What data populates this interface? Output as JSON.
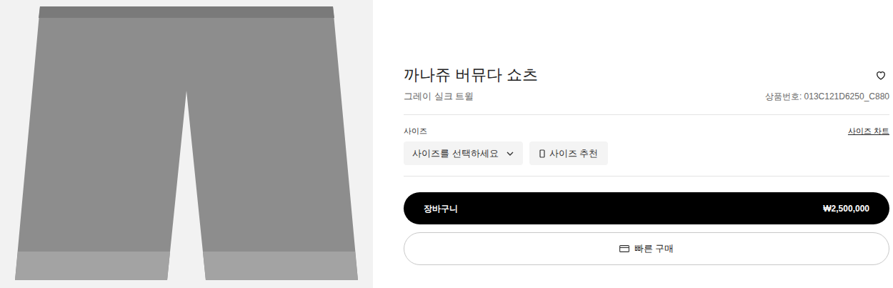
{
  "product": {
    "title": "까나쥬 버뮤다 쇼츠",
    "subtitle": "그레이 실크 트윌",
    "sku": "상품번호: 013C121D6250_C880"
  },
  "size": {
    "label": "사이즈",
    "chart_link": "사이즈 차트",
    "select_placeholder": "사이즈를 선택하세요",
    "recommend": "사이즈 추천"
  },
  "cart": {
    "label": "장바구니",
    "price": "₩2,500,000"
  },
  "quick_buy": {
    "label": "빠른 구매"
  }
}
